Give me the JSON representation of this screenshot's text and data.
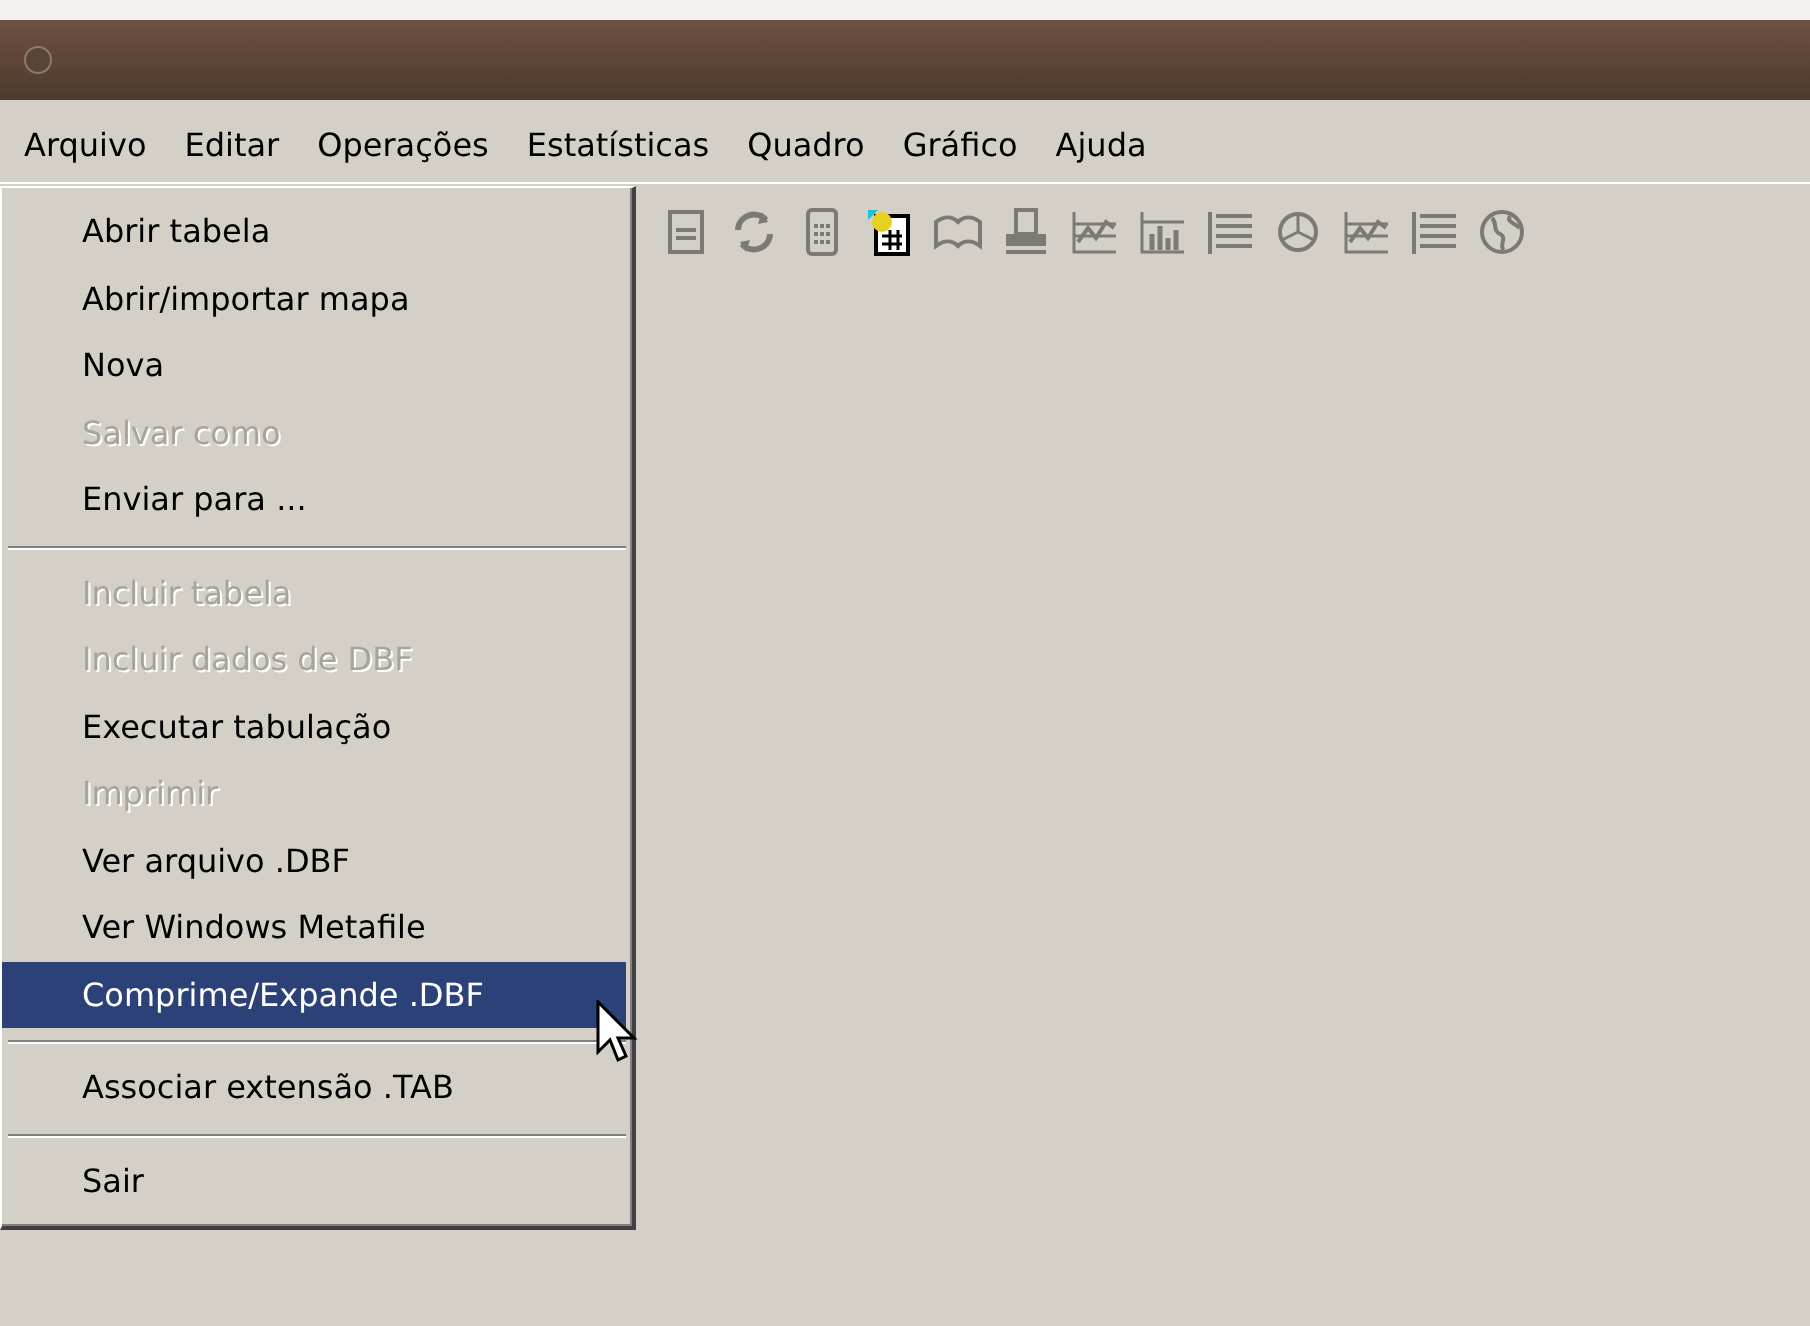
{
  "menubar": [
    "Arquivo",
    "Editar",
    "Operações",
    "Estatísticas",
    "Quadro",
    "Gráfico",
    "Ajuda"
  ],
  "menu": {
    "items": [
      {
        "kind": "item",
        "label": "Abrir tabela",
        "disabled": false,
        "selected": false
      },
      {
        "kind": "item",
        "label": "Abrir/importar mapa",
        "disabled": false,
        "selected": false
      },
      {
        "kind": "item",
        "label": "Nova",
        "disabled": false,
        "selected": false
      },
      {
        "kind": "item",
        "label": "Salvar como",
        "disabled": true,
        "selected": false
      },
      {
        "kind": "item",
        "label": "Enviar para ...",
        "disabled": false,
        "selected": false
      },
      {
        "kind": "separator"
      },
      {
        "kind": "item",
        "label": "Incluir tabela",
        "disabled": true,
        "selected": false
      },
      {
        "kind": "item",
        "label": "Incluir dados de DBF",
        "disabled": true,
        "selected": false
      },
      {
        "kind": "item",
        "label": "Executar tabulação",
        "disabled": false,
        "selected": false
      },
      {
        "kind": "item",
        "label": "Imprimir",
        "disabled": true,
        "selected": false
      },
      {
        "kind": "item",
        "label": "Ver arquivo .DBF",
        "disabled": false,
        "selected": false
      },
      {
        "kind": "item",
        "label": "Ver Windows Metafile",
        "disabled": false,
        "selected": false
      },
      {
        "kind": "item",
        "label": "Comprime/Expande .DBF",
        "disabled": false,
        "selected": true
      },
      {
        "kind": "separator"
      },
      {
        "kind": "item",
        "label": "Associar extensão .TAB",
        "disabled": false,
        "selected": false
      },
      {
        "kind": "separator"
      },
      {
        "kind": "item",
        "label": "Sair",
        "disabled": false,
        "selected": false
      }
    ]
  }
}
